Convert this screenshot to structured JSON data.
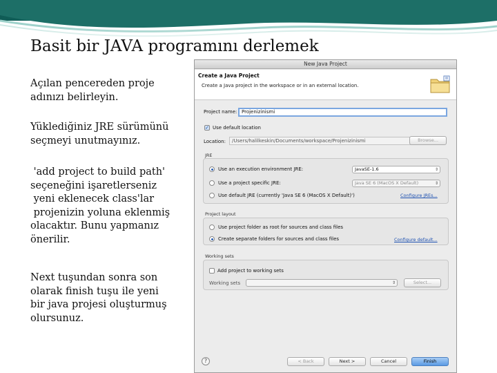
{
  "slide": {
    "title": "Basit bir JAVA programını derlemek",
    "paragraphs": [
      {
        "lines": [
          "Açılan pencereden proje",
          "adınızı belirleyin."
        ]
      },
      {
        "lines": [
          "Yüklediğiniz JRE sürümünü",
          "seçmeyi unutmayınız."
        ]
      },
      {
        "lines": [
          " 'add project to build path'",
          "seçeneğini işaretlerseniz",
          " yeni eklenecek class'lar",
          " projenizin yoluna eklenmiş",
          "olacaktır. Bunu yapmanız",
          "önerilir."
        ]
      },
      {
        "lines": [
          "Next tuşundan sonra son",
          "olarak finish tuşu ile yeni",
          "bir java projesi oluşturmuş",
          "olursunuz."
        ]
      }
    ],
    "banner_color": "#1d6f67"
  },
  "dialog": {
    "window_title": "New Java Project",
    "header_title": "Create a Java Project",
    "header_desc": "Create a Java project in the workspace or in an external location.",
    "header_icon": "folder-icon",
    "project_name_label": "Project name:",
    "project_name_value": "Projenizinismi",
    "use_default_location_label": "Use default location",
    "use_default_location_checked": true,
    "location_label": "Location:",
    "location_value": "/Users/halilkeskin/Documents/workspace/Projenizinismi",
    "browse_label": "Browse...",
    "jre": {
      "group_label": "JRE",
      "options": [
        {
          "label": "Use an execution environment JRE:",
          "selected": true,
          "select_value": "JavaSE-1.6"
        },
        {
          "label": "Use a project specific JRE:",
          "selected": false,
          "select_value": "Java SE 6 (MacOS X Default)"
        },
        {
          "label": "Use default JRE (currently 'Java SE 6 (MacOS X Default)')",
          "selected": false,
          "link": "Configure JREs..."
        }
      ]
    },
    "layout": {
      "group_label": "Project layout",
      "options": [
        {
          "label": "Use project folder as root for sources and class files",
          "selected": false
        },
        {
          "label": "Create separate folders for sources and class files",
          "selected": true,
          "link": "Configure default..."
        }
      ]
    },
    "working_sets": {
      "group_label": "Working sets",
      "add_label": "Add project to working sets",
      "add_checked": false,
      "sets_label": "Working sets",
      "sets_value": "",
      "select_label": "Select..."
    },
    "buttons": {
      "help": "?",
      "back": "< Back",
      "next": "Next >",
      "cancel": "Cancel",
      "finish": "Finish"
    },
    "accent_color": "#5a9ae3"
  }
}
